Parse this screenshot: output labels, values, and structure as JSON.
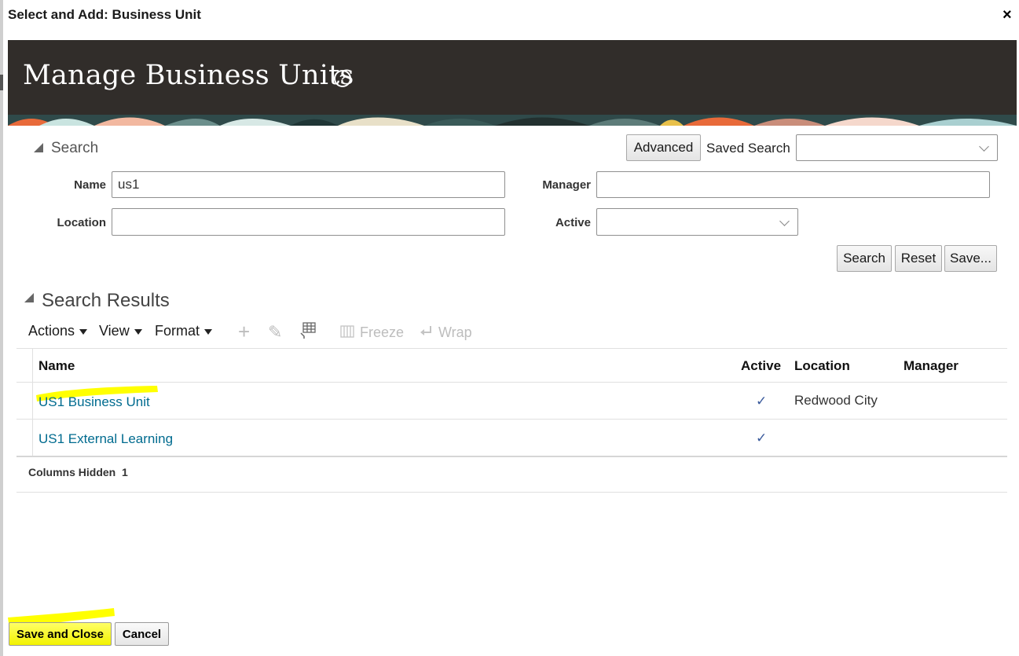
{
  "dialog": {
    "title": "Select and Add: Business Unit",
    "close": "×"
  },
  "header": {
    "title": "Manage Business Units",
    "help": "?"
  },
  "search": {
    "section_label": "Search",
    "advanced_label": "Advanced",
    "saved_search_label": "Saved Search",
    "saved_search_value": "",
    "fields": {
      "name_label": "Name",
      "name_value": "us1",
      "manager_label": "Manager",
      "manager_value": "",
      "location_label": "Location",
      "location_value": "",
      "active_label": "Active",
      "active_value": ""
    },
    "buttons": {
      "search": "Search",
      "reset": "Reset",
      "save": "Save..."
    }
  },
  "results": {
    "section_label": "Search Results",
    "toolbar": {
      "actions": "Actions",
      "view": "View",
      "format": "Format",
      "add": "+",
      "edit": "✎",
      "freeze": "Freeze",
      "wrap": "Wrap"
    },
    "columns": [
      "Name",
      "Active",
      "Location",
      "Manager"
    ],
    "rows": [
      {
        "name": "US1 Business Unit",
        "active": "✓",
        "location": "Redwood City",
        "manager": ""
      },
      {
        "name": "US1 External Learning",
        "active": "✓",
        "location": "",
        "manager": ""
      }
    ],
    "footer": {
      "hidden_label": "Columns Hidden",
      "hidden_count": "1"
    }
  },
  "footer": {
    "save_close": "Save and Close",
    "cancel": "Cancel"
  },
  "colors": {
    "banner": "#312d2a",
    "link": "#006b8f",
    "highlight": "#ffff00"
  }
}
